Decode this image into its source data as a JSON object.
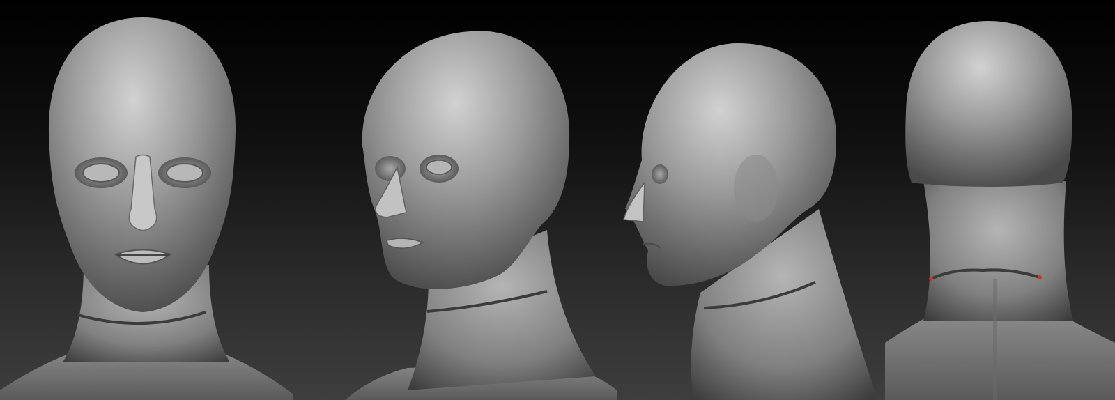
{
  "scene": {
    "description_visible_text": "",
    "background_gradient": [
      "#000000",
      "#101010",
      "#2b2b2b",
      "#3e3e3e"
    ],
    "material_color": "#8e8e8e",
    "material_highlight": "#cfcfcf",
    "material_shadow": "#3a3a3a",
    "neck_curve_color": "#3b3b3b",
    "marker_color": "#c0392b"
  },
  "views": [
    {
      "key": "front",
      "icon": "head-front-view"
    },
    {
      "key": "three-quarter",
      "icon": "head-three-quarter-view"
    },
    {
      "key": "side",
      "icon": "head-side-view"
    },
    {
      "key": "back",
      "icon": "head-back-view"
    }
  ]
}
